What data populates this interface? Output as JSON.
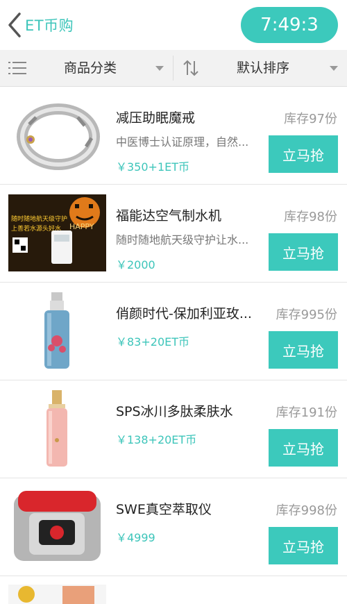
{
  "header": {
    "title": "ET币购",
    "timer": "7:49:3"
  },
  "filters": {
    "category_label": "商品分类",
    "sort_label": "默认排序"
  },
  "products": [
    {
      "name": "减压助眠魔戒",
      "desc": "中医博士认证原理，自然...",
      "price": "￥350+1ET币",
      "stock": "库存97份",
      "buy": "立马抢"
    },
    {
      "name": "福能达空气制水机",
      "desc": "随时随地航天级守护让水...",
      "price": "￥2000",
      "stock": "库存98份",
      "buy": "立马抢"
    },
    {
      "name": "俏颜时代-保加利亚玫...",
      "desc": "",
      "price": "￥83+20ET币",
      "stock": "库存995份",
      "buy": "立马抢"
    },
    {
      "name": "SPS冰川多肽柔肤水",
      "desc": "",
      "price": "￥138+20ET币",
      "stock": "库存191份",
      "buy": "立马抢"
    },
    {
      "name": "SWE真空萃取仪",
      "desc": "",
      "price": "￥4999",
      "stock": "库存998份",
      "buy": "立马抢"
    }
  ],
  "poster_text": {
    "happy": "HAPPY",
    "line1": "随时随地航天级守护",
    "line2": "上善若水源头好水"
  },
  "colors": {
    "accent": "#3cc9bc"
  }
}
